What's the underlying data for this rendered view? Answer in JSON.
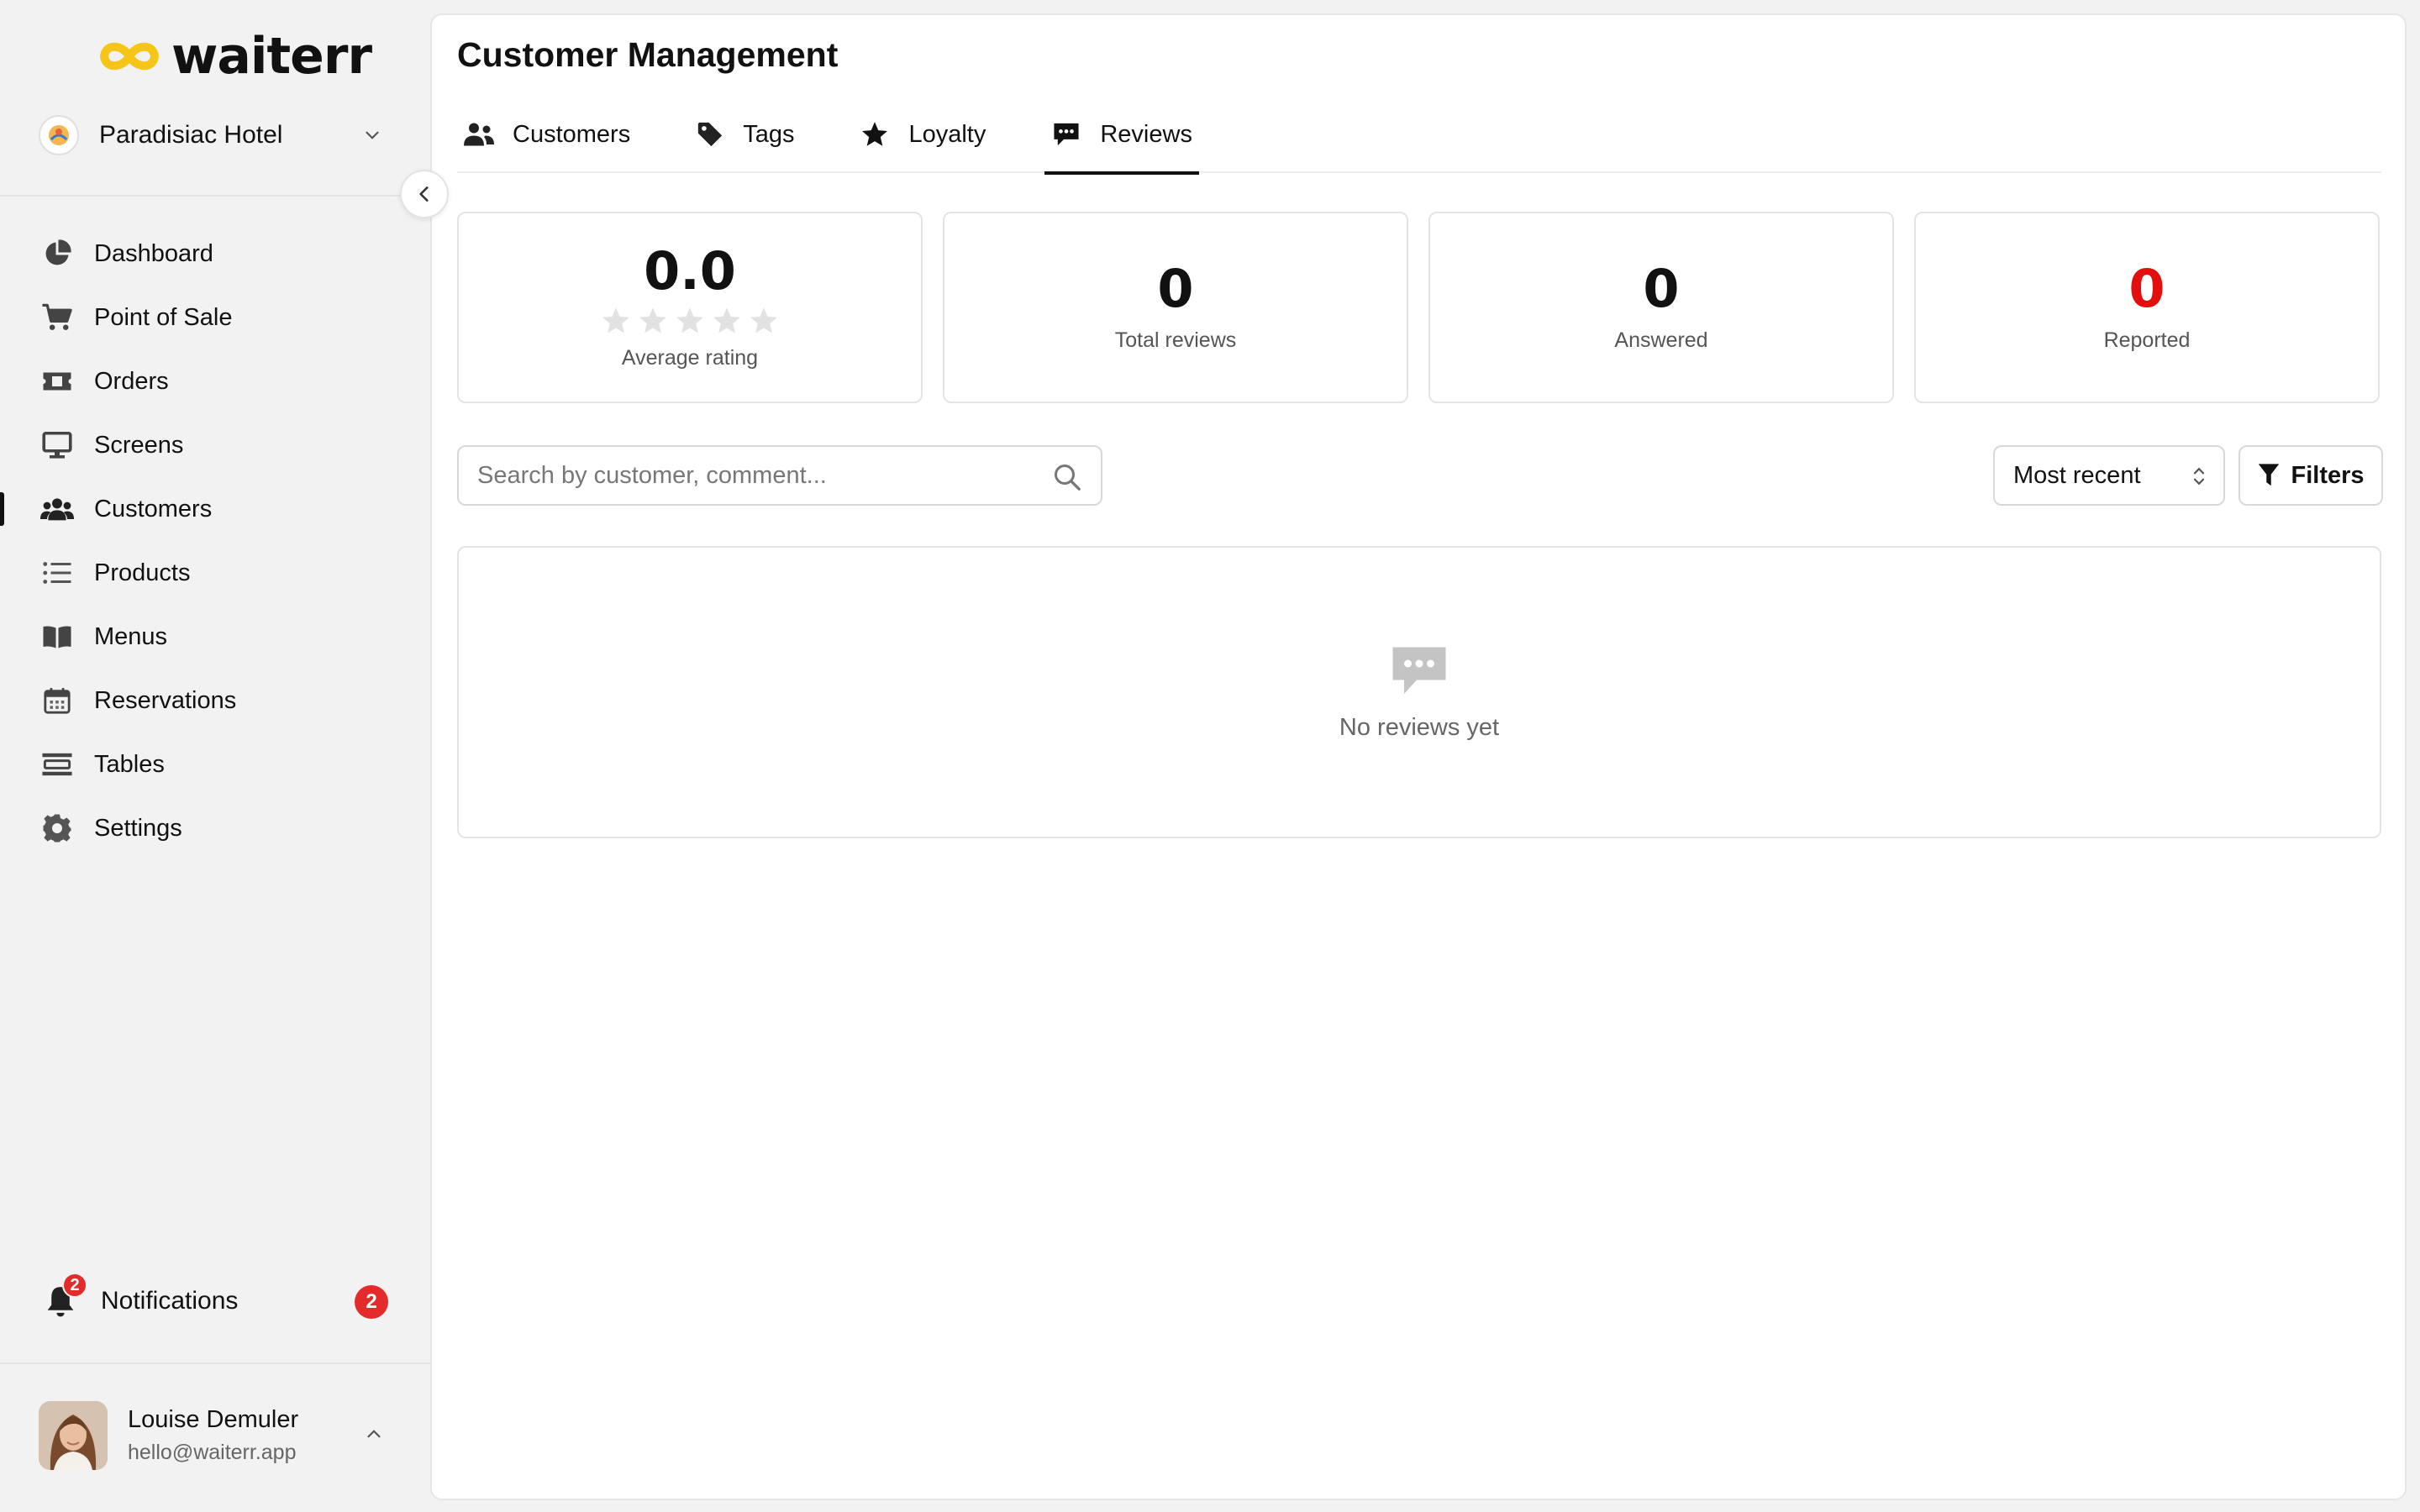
{
  "app": {
    "brand": "waiterr",
    "venue": "Paradisiac Hotel"
  },
  "sidebar": {
    "items": [
      {
        "label": "Dashboard",
        "icon": "pie-chart-icon"
      },
      {
        "label": "Point of Sale",
        "icon": "cart-icon"
      },
      {
        "label": "Orders",
        "icon": "ticket-icon"
      },
      {
        "label": "Screens",
        "icon": "monitor-icon"
      },
      {
        "label": "Customers",
        "icon": "users-icon",
        "active": true
      },
      {
        "label": "Products",
        "icon": "list-icon"
      },
      {
        "label": "Menus",
        "icon": "book-icon"
      },
      {
        "label": "Reservations",
        "icon": "calendar-icon"
      },
      {
        "label": "Tables",
        "icon": "table-icon"
      },
      {
        "label": "Settings",
        "icon": "gear-icon"
      }
    ],
    "notifications": {
      "label": "Notifications",
      "count": "2"
    },
    "user": {
      "name": "Louise Demuler",
      "email": "hello@waiterr.app"
    }
  },
  "page": {
    "title": "Customer Management",
    "tabs": [
      {
        "label": "Customers",
        "icon": "users-icon"
      },
      {
        "label": "Tags",
        "icon": "tag-icon"
      },
      {
        "label": "Loyalty",
        "icon": "star-icon"
      },
      {
        "label": "Reviews",
        "icon": "speech-bubble-icon",
        "active": true
      }
    ]
  },
  "stats": {
    "average_rating": {
      "value": "0.0",
      "label": "Average rating",
      "stars_filled": 0,
      "stars_total": 5
    },
    "total_reviews": {
      "value": "0",
      "label": "Total reviews"
    },
    "answered": {
      "value": "0",
      "label": "Answered"
    },
    "reported": {
      "value": "0",
      "label": "Reported"
    }
  },
  "toolbar": {
    "search_placeholder": "Search by customer, comment...",
    "sort_value": "Most recent",
    "filters_label": "Filters"
  },
  "empty_state": {
    "message": "No reviews yet"
  },
  "colors": {
    "brand_yellow": "#F5C518",
    "alert_red": "#E32B2B",
    "reported_red": "#E30E0E",
    "star_empty": "#E2E2E2"
  }
}
